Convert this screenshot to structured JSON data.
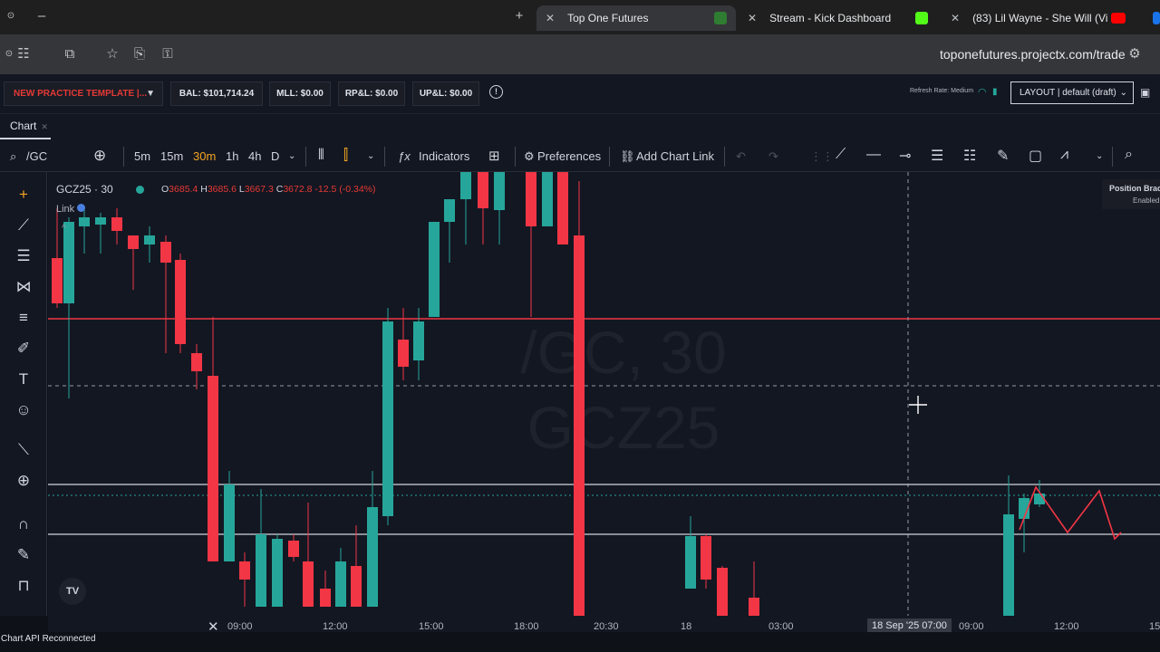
{
  "browser": {
    "tabs": [
      {
        "title": "Top One Futures",
        "active": true,
        "favicon_color": "#2e7d32"
      },
      {
        "title": "Stream - Kick Dashboard",
        "active": false,
        "favicon_color": "#53fc18"
      },
      {
        "title": "(83) Lil Wayne - She Will (Vi",
        "active": false,
        "favicon_color": "#ff0000"
      }
    ],
    "url": "toponefutures.projectx.com/trade"
  },
  "header": {
    "template": "NEW PRACTICE TEMPLATE |...",
    "bal": "BAL: $101,714.24",
    "mll": "MLL: $0.00",
    "rpl": "RP&L: $0.00",
    "upl": "UP&L: $0.00",
    "refresh": "Refresh Rate: Medium",
    "layout": "LAYOUT | default (draft)"
  },
  "chart_tab": {
    "label": "Chart"
  },
  "toolbar": {
    "symbol": "/GC",
    "timeframes": [
      "5m",
      "15m",
      "30m",
      "1h",
      "4h",
      "D"
    ],
    "active_timeframe": "30m",
    "indicators_label": "Indicators",
    "preferences_label": "Preferences",
    "add_link_label": "Add Chart Link"
  },
  "legend": {
    "symbol": "GCZ25 · 30",
    "o_label": "O",
    "o": "3685.4",
    "h_label": "H",
    "h": "3685.6",
    "l_label": "L",
    "l": "3667.3",
    "c_label": "C",
    "c": "3672.8",
    "change": "-12.5 (-0.34%)",
    "link": "Link"
  },
  "watermark": {
    "line1": "/GC, 30",
    "line2": "GCZ25"
  },
  "position_bracket": {
    "title": "Position Brac",
    "status": "Enabled"
  },
  "time_axis": {
    "labels": [
      "09:00",
      "12:00",
      "15:00",
      "18:00",
      "20:30",
      "18",
      "03:00",
      "09:00",
      "12:00",
      "15"
    ],
    "crosshair_label": "18 Sep '25  07:00"
  },
  "status_bar": {
    "text": "Chart API Reconnected"
  },
  "colors": {
    "up": "#26a69a",
    "down": "#f23645",
    "accent": "#f5a623",
    "background": "#131722"
  },
  "icons": [
    "plus-icon",
    "close-icon",
    "star-icon",
    "crosshair-icon",
    "trendline-icon",
    "indicators-icon",
    "gear-icon",
    "link-icon",
    "magnet-icon",
    "lock-icon",
    "zoom-icon",
    "search-icon"
  ]
}
